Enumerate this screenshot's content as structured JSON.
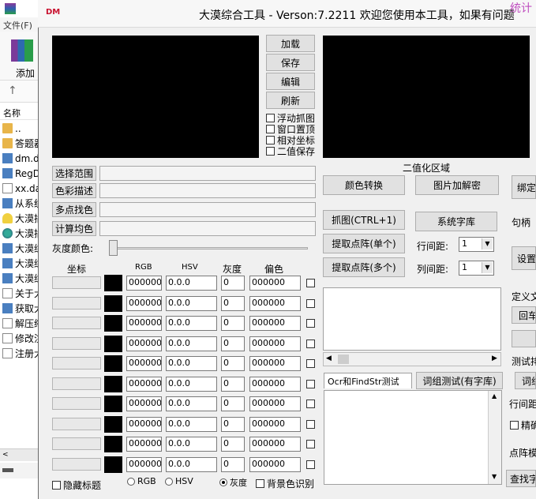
{
  "explorer": {
    "menu": "文件(F)",
    "ribbon_label": "添加",
    "back_glyph": "↑",
    "header": "名称",
    "items": [
      "..",
      "答题器",
      "dm.dll",
      "RegDll",
      "xx.dat",
      "从系统",
      "大漠插",
      "大漠插",
      "大漠综",
      "大漠综",
      "大漠综",
      "关于大",
      "获取大",
      "解压缩",
      "修改注",
      "注册大"
    ]
  },
  "window": {
    "logo": "DM",
    "title": "大漠综合工具 - Verson:7.2211 欢迎您使用本工具，如果有问题",
    "corner": "统计"
  },
  "left_buttons": [
    "加载",
    "保存",
    "编辑",
    "刷新"
  ],
  "checks": [
    "浮动抓图",
    "窗口置顶",
    "相对坐标",
    "二值保存"
  ],
  "binary_label": "二值化区域",
  "side_buttons": [
    "选择范围",
    "色彩描述",
    "多点找色",
    "计算均色"
  ],
  "gray_label": "灰度颜色:",
  "col_headers": {
    "coord": "坐标",
    "rgb": "RGB",
    "hsv": "HSV",
    "gray": "灰度",
    "offset": "偏色"
  },
  "rows": [
    {
      "rgb": "000000",
      "hsv": "0.0.0",
      "gray": "0",
      "offset": "000000"
    },
    {
      "rgb": "000000",
      "hsv": "0.0.0",
      "gray": "0",
      "offset": "000000"
    },
    {
      "rgb": "000000",
      "hsv": "0.0.0",
      "gray": "0",
      "offset": "000000"
    },
    {
      "rgb": "000000",
      "hsv": "0.0.0",
      "gray": "0",
      "offset": "000000"
    },
    {
      "rgb": "000000",
      "hsv": "0.0.0",
      "gray": "0",
      "offset": "000000"
    },
    {
      "rgb": "000000",
      "hsv": "0.0.0",
      "gray": "0",
      "offset": "000000"
    },
    {
      "rgb": "000000",
      "hsv": "0.0.0",
      "gray": "0",
      "offset": "000000"
    },
    {
      "rgb": "000000",
      "hsv": "0.0.0",
      "gray": "0",
      "offset": "000000"
    },
    {
      "rgb": "000000",
      "hsv": "0.0.0",
      "gray": "0",
      "offset": "000000"
    },
    {
      "rgb": "000000",
      "hsv": "0.0.0",
      "gray": "0",
      "offset": "000000"
    }
  ],
  "bottom": {
    "hide_title": "隐藏标题",
    "radio_rgb": "RGB",
    "radio_hsv": "HSV",
    "radio_gray": "灰度",
    "bg_recog": "背景色识别"
  },
  "right": {
    "color_convert": "颜色转换",
    "image_decrypt": "图片加解密",
    "bind": "绑定",
    "capture": "抓图(CTRL+1)",
    "sys_font": "系统字库",
    "handle": "句柄",
    "extract_single": "提取点阵(单个)",
    "line_spacing": "行间距:",
    "line_val": "1",
    "extract_multi": "提取点阵(多个)",
    "col_spacing": "列间距:",
    "col_val": "1",
    "settings": "设置",
    "define": "定义文",
    "enter": "回车",
    "test_label": "测试排",
    "tab_ocr": "Ocr和FindStr测试",
    "tab_words": "词组测试(有字库)",
    "tab_more": "词组",
    "line_pitch": "行间距",
    "precise": "精确",
    "lattice": "点阵模",
    "find_word": "查找字"
  }
}
